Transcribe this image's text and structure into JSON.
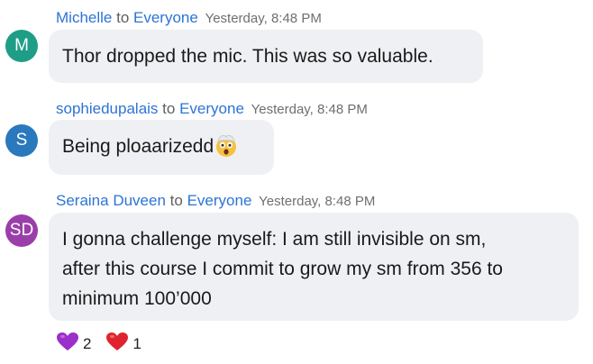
{
  "messages": [
    {
      "sender": "Michelle",
      "to": "to",
      "recipient": "Everyone",
      "time": "Yesterday, 8:48 PM",
      "avatar_initials": "M",
      "avatar_color": "#1e9e86",
      "lines": [
        "Thor dropped the mic. This was so valuable."
      ]
    },
    {
      "sender": "sophiedupalais",
      "to": "to",
      "recipient": "Everyone",
      "time": "Yesterday, 8:48 PM",
      "avatar_initials": "S",
      "avatar_color": "#2a78bd",
      "lines": [
        "Being ploaarizedd"
      ],
      "trailing_emoji": "exploding-head"
    },
    {
      "sender": "Seraina Duveen",
      "to": "to",
      "recipient": "Everyone",
      "time": "Yesterday, 8:48 PM",
      "avatar_initials": "SD",
      "avatar_color": "#9a3fa9",
      "lines": [
        "I gonna challenge myself: I am still invisible on sm,",
        "after this course I commit to grow my sm from 356 to",
        "minimum 100’000"
      ]
    }
  ],
  "reactions": [
    {
      "icon": "purple-heart-icon",
      "color": "#9b2fc9",
      "count": "2"
    },
    {
      "icon": "red-heart-icon",
      "color": "#e0242f",
      "count": "1"
    }
  ]
}
